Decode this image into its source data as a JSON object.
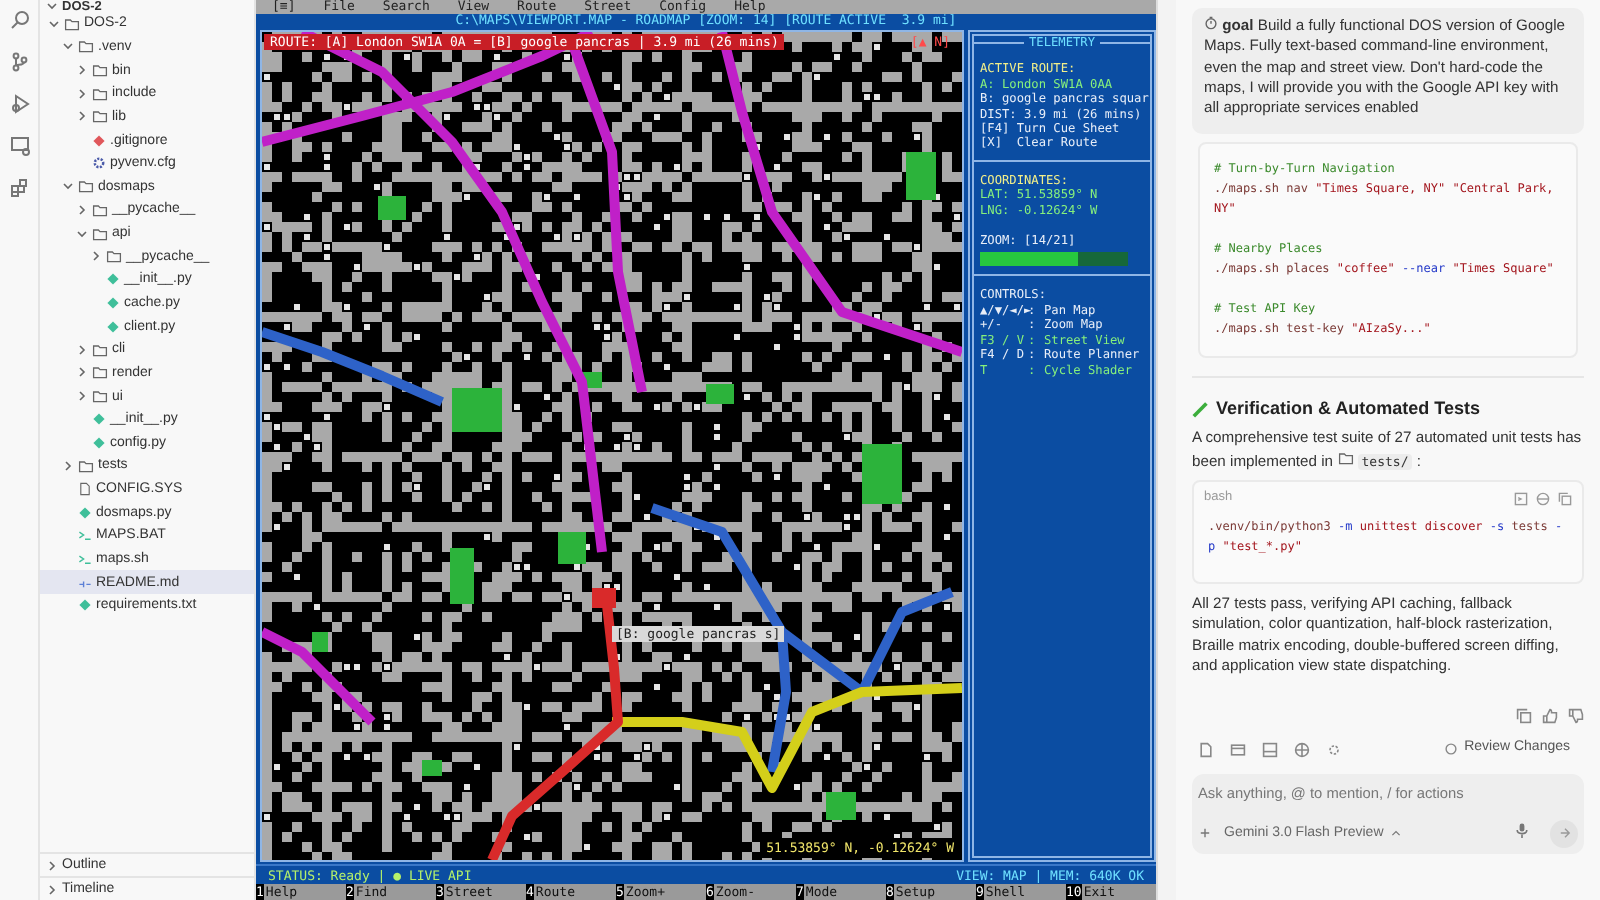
{
  "explorer": {
    "header": {
      "label": "DOS-2",
      "expanded": true
    },
    "tree": [
      {
        "name": "DOS-2",
        "kind": "folder",
        "expanded": true,
        "selected": false,
        "children": [
          {
            "name": ".venv",
            "kind": "folder",
            "expanded": true,
            "selected": false,
            "children": [
              {
                "name": "bin",
                "kind": "folder",
                "expanded": false,
                "selected": false
              },
              {
                "name": "include",
                "kind": "folder",
                "expanded": false,
                "selected": false
              },
              {
                "name": "lib",
                "kind": "folder",
                "expanded": false,
                "selected": false
              },
              {
                "name": ".gitignore",
                "kind": "git",
                "selected": false
              },
              {
                "name": "pyvenv.cfg",
                "kind": "config",
                "selected": false
              }
            ]
          },
          {
            "name": "dosmaps",
            "kind": "folder",
            "expanded": true,
            "selected": false,
            "children": [
              {
                "name": "__pycache__",
                "kind": "folder",
                "expanded": false,
                "selected": false
              },
              {
                "name": "api",
                "kind": "folder",
                "expanded": true,
                "selected": false,
                "children": [
                  {
                    "name": "__pycache__",
                    "kind": "folder",
                    "expanded": false,
                    "selected": false
                  },
                  {
                    "name": "__init__.py",
                    "kind": "python",
                    "selected": false
                  },
                  {
                    "name": "cache.py",
                    "kind": "python",
                    "selected": false
                  },
                  {
                    "name": "client.py",
                    "kind": "python",
                    "selected": false
                  }
                ]
              },
              {
                "name": "cli",
                "kind": "folder",
                "expanded": false,
                "selected": false
              },
              {
                "name": "render",
                "kind": "folder",
                "expanded": false,
                "selected": false
              },
              {
                "name": "ui",
                "kind": "folder",
                "expanded": false,
                "selected": false
              },
              {
                "name": "__init__.py",
                "kind": "python",
                "selected": false
              },
              {
                "name": "config.py",
                "kind": "python",
                "selected": false
              }
            ]
          },
          {
            "name": "tests",
            "kind": "folder",
            "expanded": false,
            "selected": false
          },
          {
            "name": "CONFIG.SYS",
            "kind": "file",
            "selected": false
          },
          {
            "name": "dosmaps.py",
            "kind": "python",
            "selected": false
          },
          {
            "name": "MAPS.BAT",
            "kind": "terminal",
            "selected": false
          },
          {
            "name": "maps.sh",
            "kind": "terminal",
            "selected": false
          },
          {
            "name": "README.md",
            "kind": "markdown",
            "selected": true
          },
          {
            "name": "requirements.txt",
            "kind": "python",
            "selected": false
          }
        ]
      }
    ],
    "sections": [
      {
        "label": "Outline",
        "expanded": false
      },
      {
        "label": "Timeline",
        "expanded": false
      }
    ]
  },
  "dos": {
    "menu": [
      "[≡]",
      "File",
      "Search",
      "View",
      "Route",
      "Street",
      "Config",
      "Help"
    ],
    "title": "C:\\MAPS\\VIEWPORT.MAP - ROADMAP [ZOOM: 14] [ROUTE ACTIVE  3.9 mi]",
    "route_banner": "ROUTE: [A] London SW1A 0A = [B] google pancras | 3.9 mi (26 mins)",
    "compass": "[▲ N]",
    "marker_label": "[B: google pancras s]",
    "map_coords": "51.53859° N, -0.12624° W",
    "telemetry": {
      "title": "TELEMETRY",
      "route": [
        {
          "text": "ACTIVE ROUTE:",
          "kind": "heading"
        },
        {
          "text": "A: London SW1A 0AA",
          "kind": "highlight"
        },
        {
          "text": "B: google pancras squar",
          "kind": "plain"
        },
        {
          "text": "DIST: 3.9 mi (26 mins)",
          "kind": "plain"
        },
        {
          "text": "[F4] Turn Cue Sheet",
          "kind": "plain"
        },
        {
          "text": "[X]  Clear Route",
          "kind": "plain"
        }
      ],
      "coords": [
        {
          "text": "COORDINATES:",
          "kind": "heading"
        },
        {
          "text": "LAT: 51.53859° N",
          "kind": "highlight"
        },
        {
          "text": "LNG: -0.12624° W",
          "kind": "highlight"
        }
      ],
      "zoom": {
        "label": "ZOOM: [14/21]",
        "level": 0.667
      },
      "controls_title": "CONTROLS:",
      "controls": [
        {
          "key": "▲/▼/◄/►",
          "sep": ":",
          "action": "Pan Map",
          "highlight": false
        },
        {
          "key": "+/-",
          "sep": ":",
          "action": "Zoom Map",
          "highlight": false
        },
        {
          "key": "F3 / V",
          "sep": ":",
          "action": "Street View",
          "highlight": true
        },
        {
          "key": "F4 / D",
          "sep": ":",
          "action": "Route Planner",
          "highlight": false
        },
        {
          "key": "T",
          "sep": ":",
          "action": "Cycle Shader",
          "highlight": true
        }
      ]
    },
    "status_left": "STATUS: Ready | ● LIVE API",
    "status_right": "VIEW: MAP | MEM: 640K OK",
    "fkeys": [
      {
        "num": "1",
        "label": "Help"
      },
      {
        "num": "2",
        "label": "Find"
      },
      {
        "num": "3",
        "label": "Street"
      },
      {
        "num": "4",
        "label": "Route"
      },
      {
        "num": "5",
        "label": "Zoom+"
      },
      {
        "num": "6",
        "label": "Zoom-"
      },
      {
        "num": "7",
        "label": "Mode"
      },
      {
        "num": "8",
        "label": "Setup"
      },
      {
        "num": "9",
        "label": "Shell"
      },
      {
        "num": "10",
        "label": "Exit"
      }
    ]
  },
  "chat": {
    "goal": {
      "label": "goal",
      "text": "Build a fully functional DOS version of Google Maps. Fully text-based command-line environment, even the map and street view. Don't hard-code the maps, I will provide you with the Google API key with all appropriate services enabled"
    },
    "code_groups": [
      [
        [
          {
            "kind": "comment",
            "text": "# Turn-by-Turn Navigation"
          }
        ],
        [
          {
            "kind": "cmd",
            "text": "./maps.sh nav "
          },
          {
            "kind": "string",
            "text": "\"Times Square, NY\" \"Central Park, NY\""
          }
        ]
      ],
      [
        [
          {
            "kind": "comment",
            "text": "# Nearby Places"
          }
        ],
        [
          {
            "kind": "cmd",
            "text": "./maps.sh places "
          },
          {
            "kind": "string",
            "text": "\"coffee\" "
          },
          {
            "kind": "flag",
            "text": "--near"
          },
          {
            "kind": "string",
            "text": " \"Times Square\""
          }
        ]
      ],
      [
        [
          {
            "kind": "comment",
            "text": "# Test API Key"
          }
        ],
        [
          {
            "kind": "cmd",
            "text": "./maps.sh test-key "
          },
          {
            "kind": "string",
            "text": "\"AIzaSy...\""
          }
        ]
      ]
    ],
    "heading": "Verification & Automated Tests",
    "intro": "A comprehensive test suite of 27 automated unit tests has been implemented in",
    "intro_code": "tests/",
    "intro_end": ":",
    "bash": {
      "lang": "bash",
      "lines": [
        [
          {
            "kind": "cmd",
            "text": ".venv/bin/python3 "
          },
          {
            "kind": "flag",
            "text": "-m"
          },
          {
            "kind": "string",
            "text": " unittest discover "
          },
          {
            "kind": "flag",
            "text": "-s"
          },
          {
            "kind": "cmd",
            "text": " tests "
          },
          {
            "kind": "flag",
            "text": "-p"
          },
          {
            "kind": "string",
            "text": " \"test_*.py\""
          }
        ]
      ]
    },
    "summary": "All 27 tests pass, verifying API caching, fallback simulation, color quantization, half-block rasterization, Braille matrix encoding, double-buffered screen diffing, and application view state dispatching.",
    "review_button": "Review Changes",
    "input_placeholder": "Ask anything, @ to mention, / for actions",
    "model": "Gemini 3.0 Flash Preview"
  }
}
